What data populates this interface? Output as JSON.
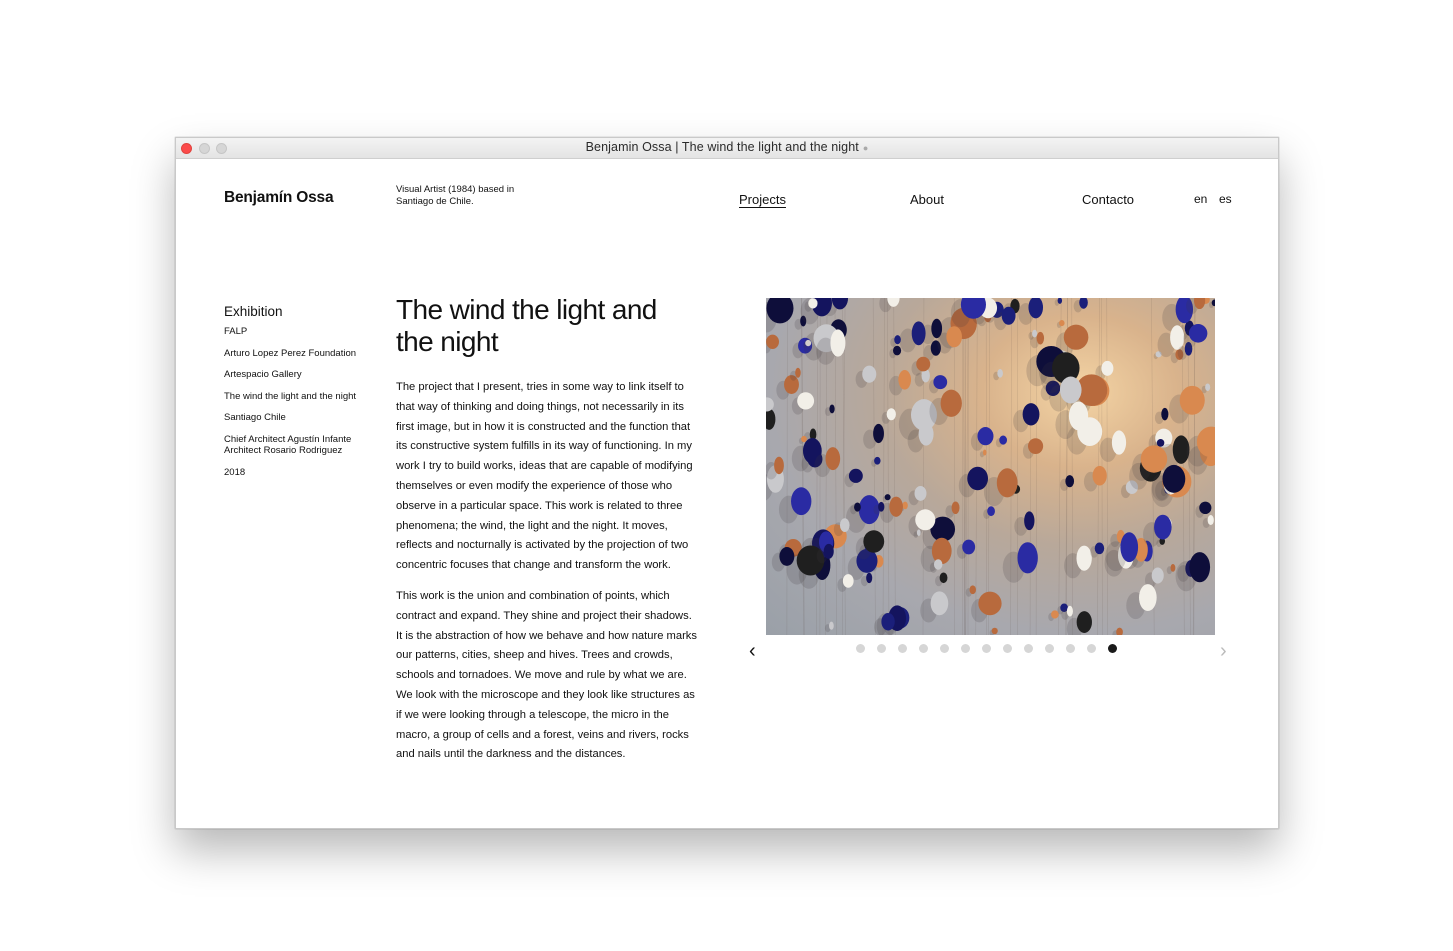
{
  "window": {
    "title": "Benjamin Ossa | The wind the light and the night"
  },
  "header": {
    "brand": "Benjamín Ossa",
    "tagline": "Visual Artist (1984) based in Santiago de Chile.",
    "nav": {
      "projects": "Projects",
      "about": "About",
      "contacto": "Contacto"
    },
    "lang": {
      "en": "en",
      "es": "es"
    }
  },
  "sidebar": {
    "heading": "Exhibition",
    "items": [
      "FALP",
      "Arturo Lopez Perez Foundation",
      "Artespacio Gallery",
      "The wind the light and the night",
      "Santiago Chile",
      "Chief Architect Agustín Infante Architect Rosario Rodriguez",
      "2018"
    ]
  },
  "project": {
    "title": "The wind the light and the night",
    "paragraphs": [
      "The project that I present, tries in some way to link itself to that way of thinking and doing things, not necessarily in its first image, but in how it is constructed and the function that its constructive system fulfills in its way of functioning. In my work I try to build works, ideas that are capable of modifying themselves or even modify the experience of those who observe in a particular space. This work is related to three phenomena; the wind, the light and the night. It moves, reflects and nocturnally is activated by the projection of two concentric focuses that change and transform the work.",
      "This work is the union and combination of points, which contract and expand. They shine and project their shadows. It is the abstraction of how we behave and how nature marks our patterns, cities, sheep and hives. Trees and crowds, schools and tornadoes. We move and rule by what we are. We look with the microscope and they look like structures as if we were looking through a telescope, the micro in the macro, a group of cells and a forest, veins and rivers, rocks and nails until the darkness and the distances."
    ]
  },
  "gallery": {
    "slide_count": 13,
    "active_index": 12,
    "prev_icon": "chevron-left-icon",
    "next_icon": "chevron-right-icon"
  },
  "colors": {
    "active_dot": "#1a1a1a",
    "inactive_dot": "#d6d6d6",
    "close_button": "#fc4b4b"
  }
}
